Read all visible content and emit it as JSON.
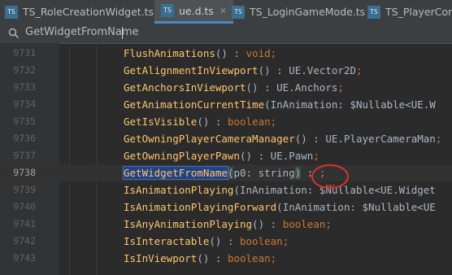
{
  "tabs": [
    {
      "label": "TS_RoleCreationWidget.ts",
      "icon": "TS",
      "active": false
    },
    {
      "label": "ue.d.ts",
      "icon": "TS",
      "active": true
    },
    {
      "label": "TS_LoginGameMode.ts",
      "icon": "TS",
      "active": false
    },
    {
      "label": "TS_PlayerContro",
      "icon": "TS",
      "active": false
    }
  ],
  "search": {
    "value": "GetWidgetFromName"
  },
  "lines": [
    {
      "num": "9731",
      "name": "FlushAnimations",
      "args": "",
      "ret": "void",
      "ret_kw": true
    },
    {
      "num": "9732",
      "name": "GetAlignmentInViewport",
      "args": "",
      "ret": "UE.Vector2D",
      "ret_kw": false
    },
    {
      "num": "9733",
      "name": "GetAnchorsInViewport",
      "args": "",
      "ret": "UE.Anchors",
      "ret_kw": false
    },
    {
      "num": "9734",
      "name": "GetAnimationCurrentTime",
      "args": "InAnimation: $Nullable<UE.W",
      "ret": "",
      "ret_kw": false
    },
    {
      "num": "9735",
      "name": "GetIsVisible",
      "args": "",
      "ret": "boolean",
      "ret_kw": true
    },
    {
      "num": "9736",
      "name": "GetOwningPlayerCameraManager",
      "args": "",
      "ret": "UE.PlayerCameraMan",
      "ret_kw": false
    },
    {
      "num": "9737",
      "name": "GetOwningPlayerPawn",
      "args": "",
      "ret": "UE.Pawn",
      "ret_kw": false
    },
    {
      "num": "9738",
      "name": "GetWidgetFromName",
      "args": "p0: string",
      "ret": "",
      "ret_kw": false
    },
    {
      "num": "9739",
      "name": "IsAnimationPlaying",
      "args": "InAnimation: $Nullable<UE.Widget",
      "ret": "",
      "ret_kw": false
    },
    {
      "num": "9740",
      "name": "IsAnimationPlayingForward",
      "args": "InAnimation: $Nullable<UE",
      "ret": "",
      "ret_kw": false
    },
    {
      "num": "9741",
      "name": "IsAnyAnimationPlaying",
      "args": "",
      "ret": "boolean",
      "ret_kw": true
    },
    {
      "num": "9742",
      "name": "IsInteractable",
      "args": "",
      "ret": "boolean",
      "ret_kw": true
    },
    {
      "num": "9743",
      "name": "IsInViewport",
      "args": "",
      "ret": "boolean",
      "ret_kw": true
    }
  ]
}
